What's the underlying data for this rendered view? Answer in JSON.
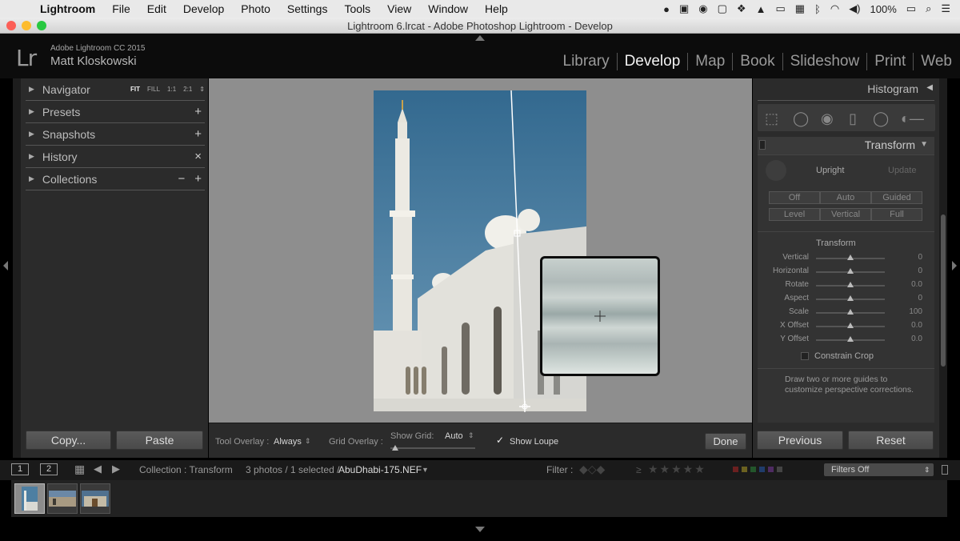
{
  "menubar": {
    "app": "Lightroom",
    "items": [
      "File",
      "Edit",
      "Develop",
      "Photo",
      "Settings",
      "Tools",
      "View",
      "Window",
      "Help"
    ],
    "battery": "100%"
  },
  "window": {
    "title": "Lightroom 6.lrcat - Adobe Photoshop Lightroom - Develop"
  },
  "identity": {
    "logo": "Lr",
    "product": "Adobe Lightroom CC 2015",
    "user": "Matt Kloskowski"
  },
  "modules": [
    "Library",
    "Develop",
    "Map",
    "Book",
    "Slideshow",
    "Print",
    "Web"
  ],
  "left_panel": {
    "navigator": {
      "label": "Navigator",
      "zoom": [
        "FIT",
        "FILL",
        "1:1",
        "2:1"
      ]
    },
    "presets": "Presets",
    "snapshots": "Snapshots",
    "history": "History",
    "collections": "Collections",
    "copy_button": "Copy...",
    "paste_button": "Paste"
  },
  "toolbar": {
    "tool_overlay_label": "Tool Overlay :",
    "tool_overlay_value": "Always",
    "grid_overlay_label": "Grid Overlay :",
    "show_grid_label": "Show Grid:",
    "show_grid_value": "Auto",
    "show_loupe_label": "Show Loupe",
    "show_loupe_checked": true,
    "done_button": "Done"
  },
  "right_panel": {
    "histogram": "Histogram",
    "transform": "Transform",
    "upright_label": "Upright",
    "update_button": "Update",
    "upright_row1": [
      "Off",
      "Auto",
      "Guided"
    ],
    "upright_row2": [
      "Level",
      "Vertical",
      "Full"
    ],
    "transform_section": "Transform",
    "sliders": [
      {
        "label": "Vertical",
        "value": "0"
      },
      {
        "label": "Horizontal",
        "value": "0"
      },
      {
        "label": "Rotate",
        "value": "0.0"
      },
      {
        "label": "Aspect",
        "value": "0"
      },
      {
        "label": "Scale",
        "value": "100"
      },
      {
        "label": "X Offset",
        "value": "0.0"
      },
      {
        "label": "Y Offset",
        "value": "0.0"
      }
    ],
    "constrain_crop": "Constrain Crop",
    "hint_line1": "Draw two or more guides to",
    "hint_line2": "customize perspective corrections.",
    "previous_button": "Previous",
    "reset_button": "Reset"
  },
  "filmbar": {
    "screen1": "1",
    "screen2": "2",
    "collection": "Collection : Transform",
    "count": "3 photos / 1 selected /",
    "filename": "AbuDhabi-175.NEF",
    "filter_label": "Filter :",
    "filter_value": "Filters Off"
  }
}
